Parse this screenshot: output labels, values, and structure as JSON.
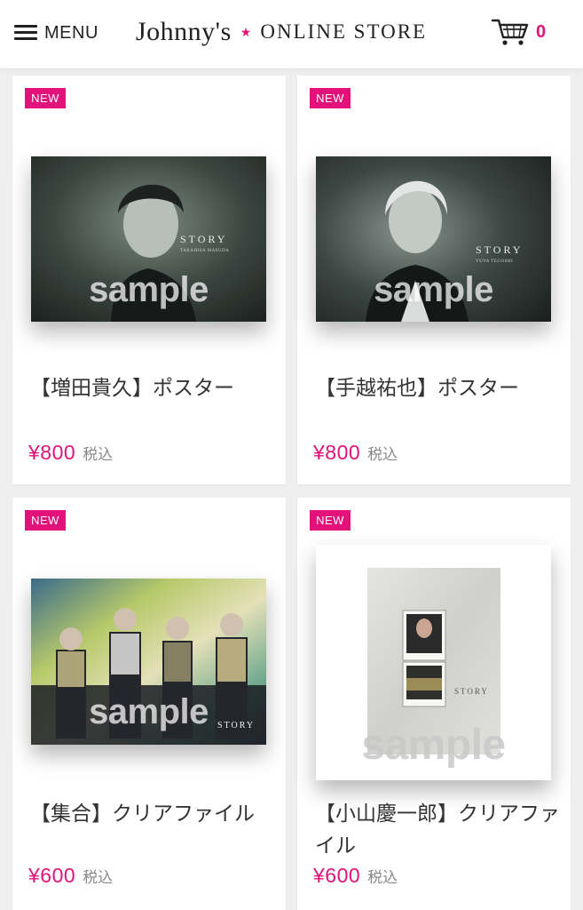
{
  "header": {
    "menu_label": "MENU",
    "logo_main": "Johnny's",
    "logo_sub": "ONLINE STORE",
    "cart_count": "0",
    "accent_color": "#e2127a"
  },
  "products": [
    {
      "badge": "NEW",
      "title": "【増田貴久】ポスター",
      "price": "¥800",
      "tax_label": "税込",
      "image_watermark": "sample",
      "image_caption": "STORY",
      "image_subcaption": "TAKAHISA MASUDA"
    },
    {
      "badge": "NEW",
      "title": "【手越祐也】ポスター",
      "price": "¥800",
      "tax_label": "税込",
      "image_watermark": "sample",
      "image_caption": "STORY",
      "image_subcaption": "YUYA TEGOSHI"
    },
    {
      "badge": "NEW",
      "title": "【集合】クリアファイル",
      "price": "¥600",
      "tax_label": "税込",
      "image_watermark": "sample",
      "image_caption": "STORY"
    },
    {
      "badge": "NEW",
      "title": "【小山慶一郎】クリアファイル",
      "price": "¥600",
      "tax_label": "税込",
      "image_watermark": "sample",
      "image_caption": "STORY"
    }
  ]
}
